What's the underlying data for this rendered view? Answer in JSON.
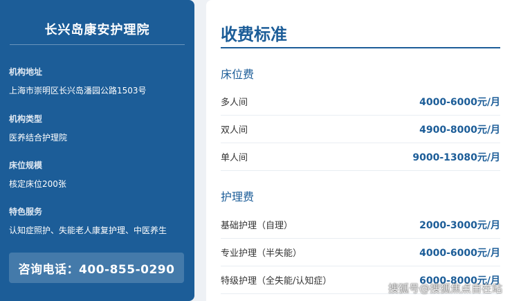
{
  "sidebar": {
    "title": "长兴岛康安护理院",
    "fields": [
      {
        "label": "机构地址",
        "value": "上海市崇明区长兴岛潘园公路1503号"
      },
      {
        "label": "机构类型",
        "value": "医养结合护理院"
      },
      {
        "label": "床位规模",
        "value": "核定床位200张"
      },
      {
        "label": "特色服务",
        "value": "认知症照护、失能老人康复护理、中医养生"
      }
    ],
    "call": "咨询电话：400-855-0290"
  },
  "panel": {
    "title": "收费标准",
    "sections": [
      {
        "heading": "床位费",
        "rows": [
          {
            "name": "多人间",
            "price": "4000-6000元/月"
          },
          {
            "name": "双人间",
            "price": "4900-8000元/月"
          },
          {
            "name": "单人间",
            "price": "9000-13080元/月"
          }
        ]
      },
      {
        "heading": "护理费",
        "rows": [
          {
            "name": "基础护理（自理）",
            "price": "2000-3000元/月"
          },
          {
            "name": "专业护理（半失能）",
            "price": "4000-6000元/月"
          },
          {
            "name": "特级护理（全失能/认知症）",
            "price": "6000-8000元/月"
          }
        ]
      }
    ]
  },
  "watermark": "搜狐号@搜狐焦点自在站"
}
